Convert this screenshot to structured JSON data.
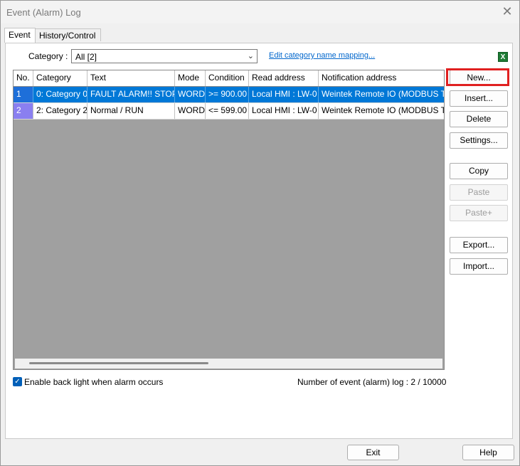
{
  "window": {
    "title": "Event (Alarm) Log",
    "close_icon": "close-icon"
  },
  "tabs": [
    {
      "label": "Event",
      "active": true
    },
    {
      "label": "History/Control",
      "active": false
    }
  ],
  "category": {
    "label": "Category :",
    "value": "All [2]",
    "link": "Edit category name mapping..."
  },
  "table": {
    "columns": [
      "No.",
      "Category",
      "Text",
      "Mode",
      "Condition",
      "Read address",
      "Notification address"
    ],
    "rows": [
      {
        "no": "1",
        "category": "0: Category 0",
        "text": "FAULT ALARM!! STOP",
        "mode": "WORD",
        "condition": ">= 900.00",
        "read": "Local HMI : LW-0",
        "notify": "Weintek Remote IO (MODBUS TCP)",
        "selected": true
      },
      {
        "no": "2",
        "category": "2: Category 2",
        "text": "Normal / RUN",
        "mode": "WORD",
        "condition": "<= 599.00",
        "read": "Local HMI : LW-0",
        "notify": "Weintek Remote IO (MODBUS TCP)",
        "selected": false
      }
    ]
  },
  "buttons": {
    "new": "New...",
    "insert": "Insert...",
    "delete": "Delete",
    "settings": "Settings...",
    "copy": "Copy",
    "paste": "Paste",
    "paste_plus": "Paste+",
    "export": "Export...",
    "import": "Import..."
  },
  "backlight": {
    "label": "Enable back light when alarm occurs",
    "checked": true
  },
  "count_text": "Number of event (alarm) log : 2 / 10000",
  "footer": {
    "exit": "Exit",
    "help": "Help"
  },
  "colors": {
    "selection": "#0078d7",
    "highlight": "#e02020"
  }
}
